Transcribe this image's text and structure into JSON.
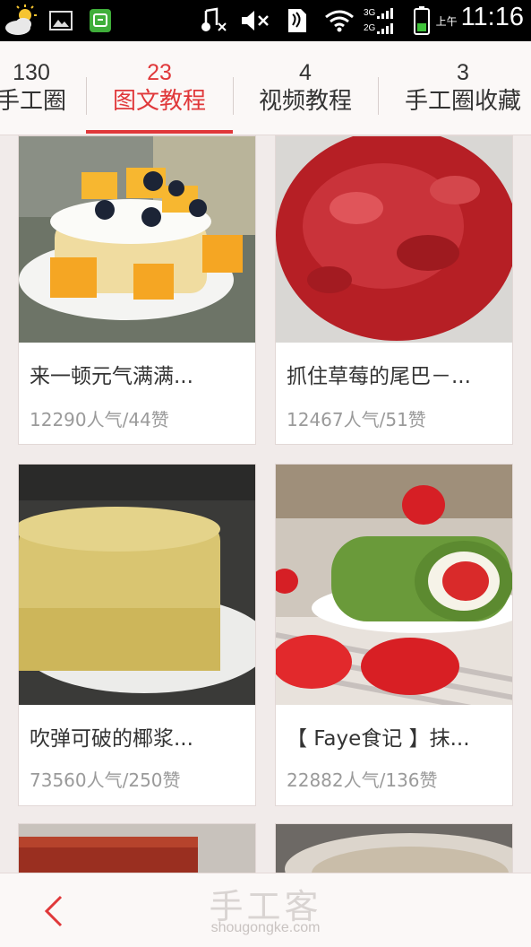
{
  "status_bar": {
    "network_labels": [
      "3G",
      "2G"
    ],
    "time_prefix": "上午",
    "time": "11:16",
    "icons": [
      "weather-cloud-sun-icon",
      "image-icon",
      "shield-app-icon",
      "music-muted-icon",
      "volume-muted-icon",
      "nfc-icon",
      "wifi-icon",
      "signal-icon",
      "battery-icon"
    ]
  },
  "tabs": [
    {
      "count": "130",
      "label": "手工圈",
      "active": false
    },
    {
      "count": "23",
      "label": "图文教程",
      "active": true
    },
    {
      "count": "4",
      "label": "视频教程",
      "active": false
    },
    {
      "count": "3",
      "label": "手工圈收藏",
      "active": false
    }
  ],
  "cards": [
    {
      "title": "来一顿元气满满...",
      "meta": "12290人气/44赞",
      "image": "mango-blueberry-cake"
    },
    {
      "title": "抓住草莓的尾巴－...",
      "meta": "12467人气/51赞",
      "image": "strawberry-jam"
    },
    {
      "title": "吹弹可破的椰浆...",
      "meta": "73560人气/250赞",
      "image": "coconut-chiffon-cake"
    },
    {
      "title": "【 Faye食记 】抹...",
      "meta": "22882人气/136赞",
      "image": "matcha-strawberry-roll"
    },
    {
      "title": "",
      "meta": "",
      "image": "red-velvet-cake"
    },
    {
      "title": "",
      "meta": "",
      "image": "bowl-dessert"
    }
  ],
  "bottom_bar": {
    "brand": "手工客",
    "url": "shougongke.com"
  },
  "colors": {
    "accent": "#e0383a",
    "background": "#f1ebea"
  }
}
